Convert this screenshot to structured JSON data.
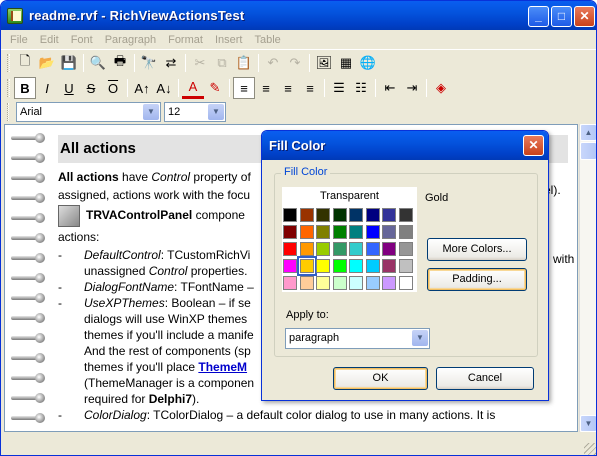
{
  "window": {
    "title": "readme.rvf - RichViewActionsTest",
    "minimize_glyph": "_",
    "maximize_glyph": "□",
    "close_glyph": "✕"
  },
  "menu": [
    "File",
    "Edit",
    "Font",
    "Paragraph",
    "Format",
    "Insert",
    "Table"
  ],
  "toolbar_row1": [
    {
      "name": "new-document-icon",
      "glyph": "🗋"
    },
    {
      "name": "open-icon",
      "glyph": "📂"
    },
    {
      "name": "save-icon",
      "glyph": "💾"
    },
    {
      "name": "print-preview-icon",
      "glyph": "🔍"
    },
    {
      "name": "print-icon",
      "glyph": "🖶"
    },
    {
      "name": "find-icon",
      "glyph": "🔭"
    },
    {
      "name": "replace-icon",
      "glyph": "⇄"
    },
    {
      "name": "cut-icon",
      "glyph": "✂"
    },
    {
      "name": "copy-icon",
      "glyph": "⧉"
    },
    {
      "name": "paste-icon",
      "glyph": "📋"
    },
    {
      "name": "undo-icon",
      "glyph": "↶"
    },
    {
      "name": "redo-icon",
      "glyph": "↷"
    },
    {
      "name": "insert-picture-icon",
      "glyph": "🖼"
    },
    {
      "name": "insert-table-icon",
      "glyph": "▦"
    },
    {
      "name": "insert-hyperlink-icon",
      "glyph": "🌐"
    }
  ],
  "toolbar_row2": [
    {
      "name": "bold-icon",
      "glyph": "B"
    },
    {
      "name": "italic-icon",
      "glyph": "I"
    },
    {
      "name": "underline-icon",
      "glyph": "U"
    },
    {
      "name": "strikeout-icon",
      "glyph": "S"
    },
    {
      "name": "overline-icon",
      "glyph": "O"
    },
    {
      "name": "grow-font-icon",
      "glyph": "A↑"
    },
    {
      "name": "shrink-font-icon",
      "glyph": "A↓"
    },
    {
      "name": "font-color-icon",
      "glyph": "A"
    },
    {
      "name": "highlight-color-icon",
      "glyph": "✎"
    },
    {
      "name": "align-left-icon",
      "glyph": "≡"
    },
    {
      "name": "align-center-icon",
      "glyph": "≡"
    },
    {
      "name": "align-right-icon",
      "glyph": "≡"
    },
    {
      "name": "justify-icon",
      "glyph": "≡"
    },
    {
      "name": "bullets-icon",
      "glyph": "☰"
    },
    {
      "name": "numbering-icon",
      "glyph": "☷"
    },
    {
      "name": "decrease-indent-icon",
      "glyph": "⇤"
    },
    {
      "name": "increase-indent-icon",
      "glyph": "⇥"
    },
    {
      "name": "fill-color-icon",
      "glyph": "◈"
    }
  ],
  "font": {
    "name": "Arial",
    "size": "12"
  },
  "doc": {
    "heading": "All actions",
    "p1_bold": "All actions",
    "p1_a": " have ",
    "p1_italic": "Control",
    "p1_b": " property of",
    "p1_c": "assigned, actions work with the focu",
    "p1_end": "el).",
    "panel_bold": "TRVAControlPanel",
    "panel_text": " compone",
    "actions_label": "actions:",
    "items": [
      {
        "l1_italic": "DefaultControl",
        "l1": ": TCustomRichVi",
        "tail": "with",
        "l2a": "unassigned ",
        "l2i": "Control",
        "l2b": " properties."
      },
      {
        "l1_italic": "DialogFontName",
        "l1": ": TFontName –"
      },
      {
        "l1_italic": "UseXPThemes",
        "l1": ": Boolean – if se",
        "l2": "dialogs will use WinXP themes",
        "l3": "themes if you'll include a manife",
        "l4": "And the rest of components (sp",
        "l5a": "themes if you'll place ",
        "l5link": "ThemeM",
        "l6": "(ThemeManager is a componen",
        "l7a": "required for ",
        "l7b": "Delphi7",
        "l7c": ")."
      },
      {
        "l1_italic": "ColorDialog",
        "l1": ": TColorDialog – a default color dialog to use in many actions. It is"
      }
    ]
  },
  "dialog": {
    "title": "Fill Color",
    "group_label": "Fill Color",
    "transparent_label": "Transparent",
    "selected_color_name": "Gold",
    "more_colors_label": "More Colors...",
    "padding_label": "Padding...",
    "apply_to_label": "Apply to:",
    "apply_to_value": "paragraph",
    "ok_label": "OK",
    "cancel_label": "Cancel",
    "palette": [
      [
        "#000000",
        "#993300",
        "#333300",
        "#003300",
        "#003366",
        "#000080",
        "#333399",
        "#333333"
      ],
      [
        "#800000",
        "#ff6600",
        "#808000",
        "#008000",
        "#008080",
        "#0000ff",
        "#666699",
        "#808080"
      ],
      [
        "#ff0000",
        "#ff9900",
        "#99cc00",
        "#339966",
        "#33cccc",
        "#3366ff",
        "#800080",
        "#969696"
      ],
      [
        "#ff00ff",
        "#ffcc00",
        "#ffff00",
        "#00ff00",
        "#00ffff",
        "#00ccff",
        "#993366",
        "#c0c0c0"
      ],
      [
        "#ff99cc",
        "#ffcc99",
        "#ffff99",
        "#ccffcc",
        "#ccffff",
        "#99ccff",
        "#cc99ff",
        "#ffffff"
      ]
    ],
    "selected_swatch": "3,1"
  }
}
